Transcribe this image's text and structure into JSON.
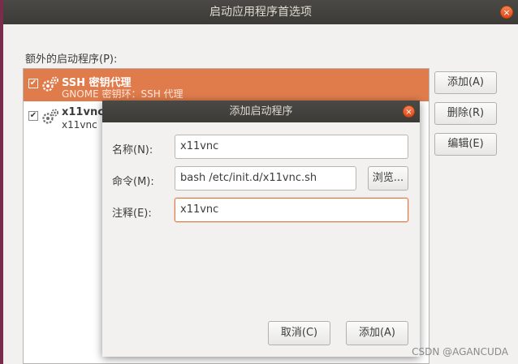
{
  "window": {
    "title": "启动应用程序首选项",
    "close_glyph": "×"
  },
  "list_label": "额外的启动程序(P):",
  "startup_items": [
    {
      "name": "SSH 密钥代理",
      "description": "GNOME 密钥环：SSH 代理",
      "checked": true,
      "selected": true,
      "check_glyph": "✔"
    },
    {
      "name": "x11vnc",
      "description": "x11vnc",
      "checked": true,
      "selected": false,
      "check_glyph": "✔"
    }
  ],
  "side_buttons": {
    "add": "添加(A)",
    "delete": "删除(R)",
    "edit": "编辑(E)"
  },
  "dialog": {
    "title": "添加启动程序",
    "close_glyph": "×",
    "name_label": "名称(N):",
    "name_value": "x11vnc",
    "command_label": "命令(M):",
    "command_value": "bash /etc/init.d/x11vnc.sh",
    "browse_label": "浏览...",
    "comment_label": "注释(E):",
    "comment_value": "x11vnc",
    "cancel_label": "取消(C)",
    "add_label": "添加(A)"
  },
  "watermark": "CSDN @AGANCUDA",
  "colors": {
    "accent": "#e07c4c",
    "titlebar": "#3c3b37",
    "close": "#df4a16"
  }
}
